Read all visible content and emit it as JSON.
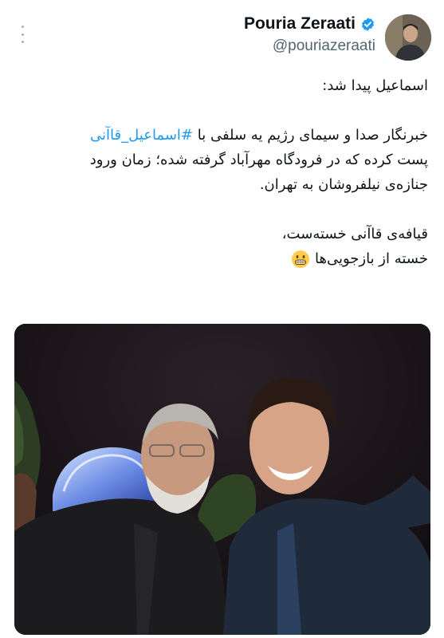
{
  "author": {
    "display_name": "Pouria Zeraati",
    "handle": "@pouriazeraati",
    "verified": true
  },
  "tweet": {
    "line1": "اسماعیل پیدا شد:",
    "line2_prefix": "خبرنگار صدا و سیمای رژیم یه سلفی با ",
    "hashtag": "#اسماعیل_قاآنی",
    "line3": "پست کرده که در فرودگاه مهرآباد گرفته شده؛ زمان ورود",
    "line4": "جنازه‌ی نیلفروشان به تهران.",
    "line5": "قیافه‌ی قاآنی خسته‌ست،",
    "line6": "خسته از بازجویی‌ها",
    "emoji": "grinning-face-icon"
  },
  "colors": {
    "link": "#1d9bf0",
    "verified": "#1d9bf0",
    "handle": "#536471",
    "text": "#0f1419"
  }
}
